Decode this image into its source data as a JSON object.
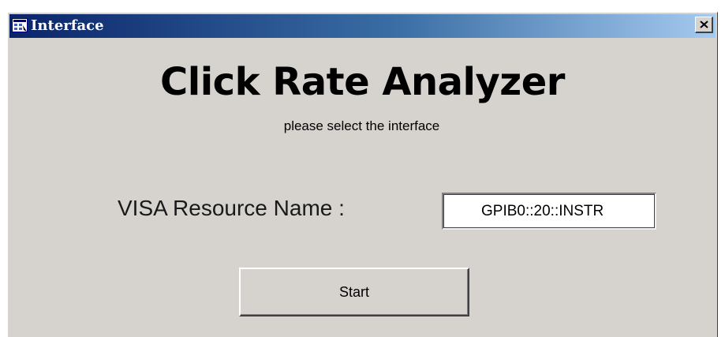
{
  "window": {
    "title": "Interface",
    "icon": "app-icon",
    "close_icon": "close-icon",
    "close_label": "×"
  },
  "main": {
    "heading": "Click Rate Analyzer",
    "subheading": "please select the interface",
    "resource_label": "VISA Resource Name :",
    "resource_value": "GPIB0::20::INSTR",
    "start_label": "Start"
  },
  "colors": {
    "face": "#d6d3ce",
    "title_start": "#0a246a",
    "title_end": "#a6caf0"
  }
}
